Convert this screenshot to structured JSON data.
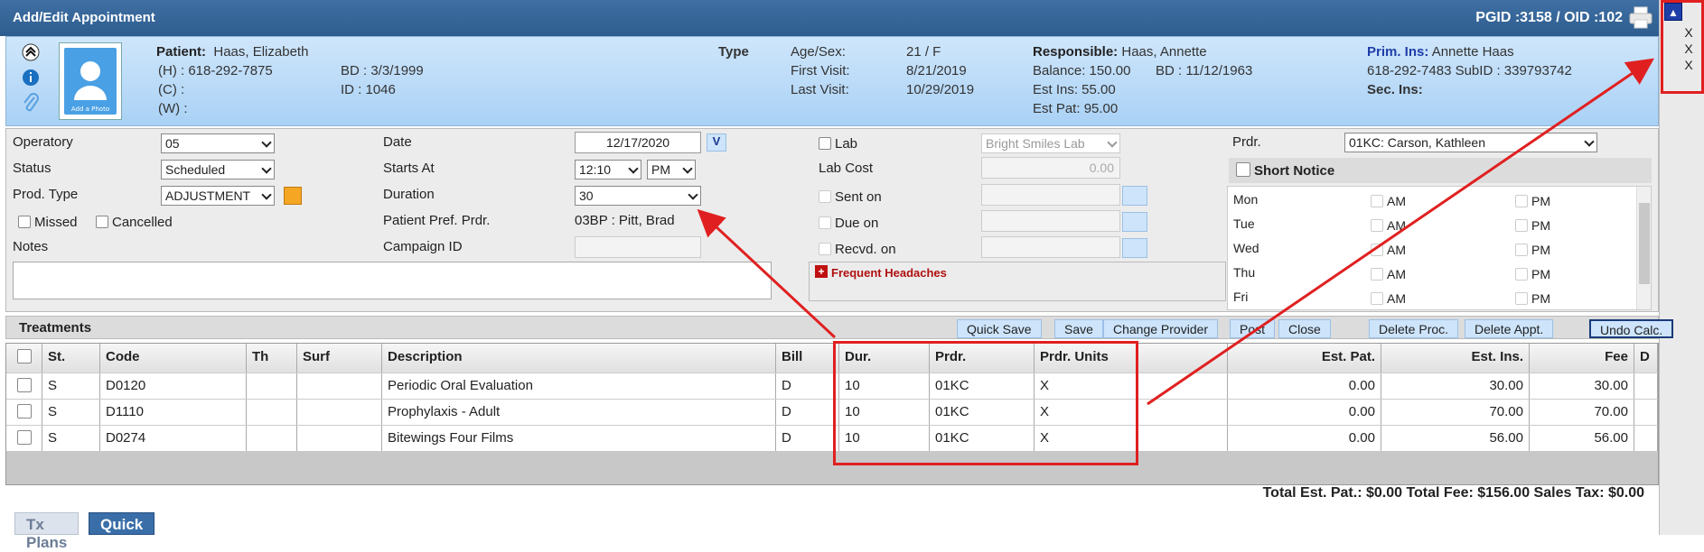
{
  "window": {
    "title": "Add/Edit Appointment",
    "ids": "PGID :3158  /  OID :102"
  },
  "side": {
    "x1": "X",
    "x2": "X",
    "x3": "X"
  },
  "patient": {
    "label": "Patient:",
    "name": "Haas, Elizabeth",
    "home": "(H) : 618-292-7875",
    "cell": "(C) :",
    "work": "(W) :",
    "bd": "BD : 3/3/1999",
    "id": "ID : 1046",
    "photo_caption": "Add a Photo",
    "type_label": "Type",
    "agesex_label": "Age/Sex:",
    "agesex": "21 / F",
    "first_label": "First Visit:",
    "first": "8/21/2019",
    "last_label": "Last Visit:",
    "last": "10/29/2019",
    "resp_label": "Responsible:",
    "resp": "Haas, Annette",
    "balance": "Balance: 150.00",
    "resp_bd": "BD : 11/12/1963",
    "est_ins": "Est Ins:  55.00",
    "est_pat": "Est Pat: 95.00",
    "prim_label": "Prim. Ins:",
    "prim": "Annette Haas",
    "prim_phone": "618-292-7483 SubID : 339793742",
    "sec_label": "Sec. Ins:"
  },
  "form": {
    "operatory_label": "Operatory",
    "operatory": "05",
    "status_label": "Status",
    "status": "Scheduled",
    "prodtype_label": "Prod. Type",
    "prodtype": "ADJUSTMENT",
    "missed": "Missed",
    "cancelled": "Cancelled",
    "notes_label": "Notes",
    "date_label": "Date",
    "date": "12/17/2020",
    "date_btn": "V",
    "starts_label": "Starts At",
    "start_time": "12:10",
    "ampm": "PM",
    "duration_label": "Duration",
    "duration": "30",
    "pref_label": "Patient Pref. Prdr.",
    "pref": "03BP : Pitt, Brad",
    "campaign_label": "Campaign ID",
    "lab_label": "Lab",
    "lab": "Bright Smiles Lab",
    "labcost_label": "Lab Cost",
    "labcost": "0.00",
    "sent_label": "Sent on",
    "due_label": "Due on",
    "recvd_label": "Recvd. on",
    "alert": "Frequent Headaches",
    "prdr_label": "Prdr.",
    "prdr": "01KC: Carson, Kathleen",
    "short_notice": "Short Notice",
    "days": [
      "Mon",
      "Tue",
      "Wed",
      "Thu",
      "Fri"
    ],
    "am": "AM",
    "pm": "PM"
  },
  "treatments": {
    "title": "Treatments",
    "buttons": [
      "Quick Save",
      "Save",
      "Change Provider",
      "Post",
      "Close",
      "Delete Proc.",
      "Delete Appt.",
      "Undo Calc."
    ],
    "columns": [
      "St.",
      "Code",
      "Th",
      "Surf",
      "Description",
      "Bill",
      "Dur.",
      "Prdr.",
      "Prdr. Units",
      "Est. Pat.",
      "Est. Ins.",
      "Fee",
      "D"
    ],
    "rows": [
      {
        "st": "S",
        "code": "D0120",
        "th": "",
        "surf": "",
        "desc": "Periodic Oral Evaluation",
        "bill": "D",
        "dur": "10",
        "prdr": "01KC",
        "units": "X",
        "estpat": "0.00",
        "estins": "30.00",
        "fee": "30.00"
      },
      {
        "st": "S",
        "code": "D1110",
        "th": "",
        "surf": "",
        "desc": "Prophylaxis - Adult",
        "bill": "D",
        "dur": "10",
        "prdr": "01KC",
        "units": "X",
        "estpat": "0.00",
        "estins": "70.00",
        "fee": "70.00"
      },
      {
        "st": "S",
        "code": "D0274",
        "th": "",
        "surf": "",
        "desc": "Bitewings Four Films",
        "bill": "D",
        "dur": "10",
        "prdr": "01KC",
        "units": "X",
        "estpat": "0.00",
        "estins": "56.00",
        "fee": "56.00"
      }
    ]
  },
  "totals": "Total Est. Pat.: $0.00   Total Fee: $156.00 Sales Tax: $0.00",
  "tabs": [
    "Tx Plans",
    "Quick Add"
  ],
  "colors": {
    "title_bar": "#2e5d8f",
    "highlight": "#e02020",
    "active_tab": "#3a6ea8"
  }
}
